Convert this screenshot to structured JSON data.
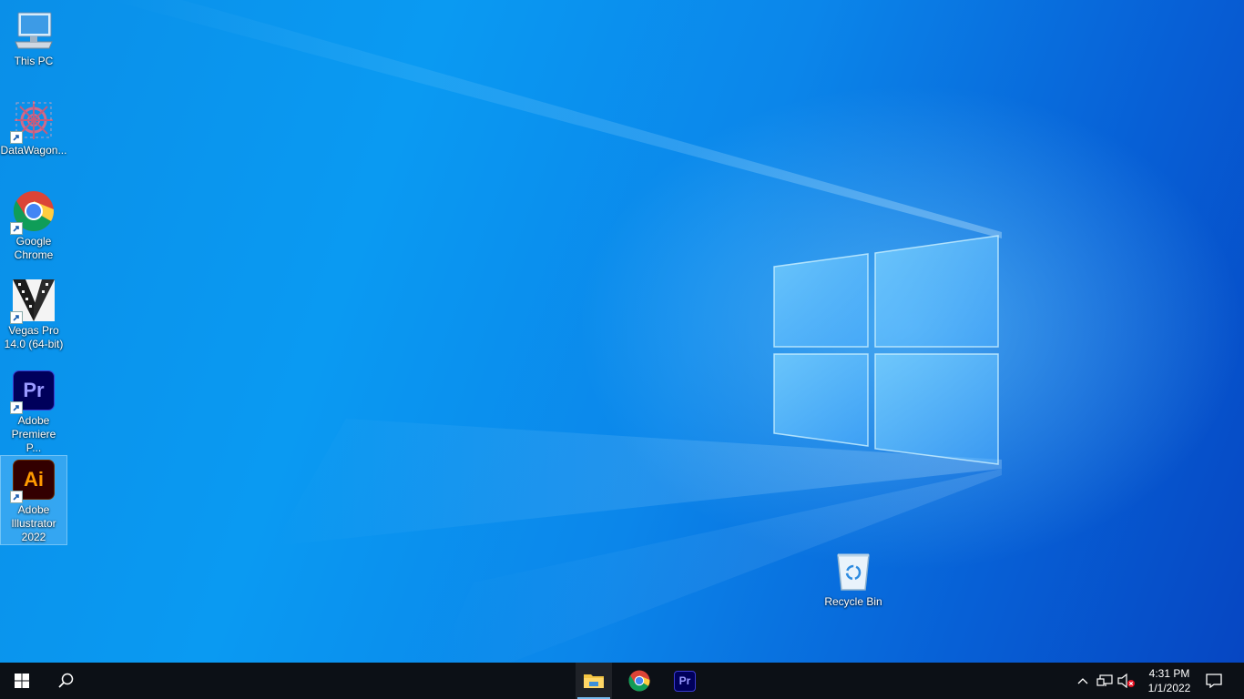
{
  "desktop": {
    "icons": [
      {
        "label": "This PC",
        "icon": "computer-icon"
      },
      {
        "label": "DataWagon...",
        "icon": "datawagon-icon"
      },
      {
        "label": "Google Chrome",
        "icon": "chrome-icon"
      },
      {
        "label": "Vegas Pro 14.0 (64-bit)",
        "icon": "vegas-pro-icon"
      },
      {
        "label": "Adobe Premiere P...",
        "icon": "premiere-icon",
        "tile_text": "Pr"
      },
      {
        "label": "Adobe Illustrator 2022",
        "icon": "illustrator-icon",
        "tile_text": "Ai",
        "selected": true
      },
      {
        "label": "Recycle Bin",
        "icon": "recycle-bin-icon"
      }
    ]
  },
  "taskbar": {
    "start_icon": "windows-start-icon",
    "search_icon": "search-icon",
    "pinned": [
      {
        "name": "File Explorer",
        "icon": "file-explorer-icon",
        "active": true
      },
      {
        "name": "Google Chrome",
        "icon": "chrome-icon"
      },
      {
        "name": "Adobe Premiere Pro",
        "icon": "premiere-icon",
        "tile_text": "Pr"
      }
    ],
    "tray": {
      "icons": [
        "chevron-up-icon",
        "network-icon",
        "volume-muted-icon"
      ],
      "time": "4:31 PM",
      "date": "1/1/2022",
      "notification_icon": "notification-icon"
    }
  },
  "colors": {
    "premiere_bg": "#00005b",
    "premiere_fg": "#9999ff",
    "illustrator_bg": "#330000",
    "illustrator_fg": "#ff9a00",
    "taskbar_bg": "#0c1016",
    "taskbar_active": "#76b9ed"
  }
}
